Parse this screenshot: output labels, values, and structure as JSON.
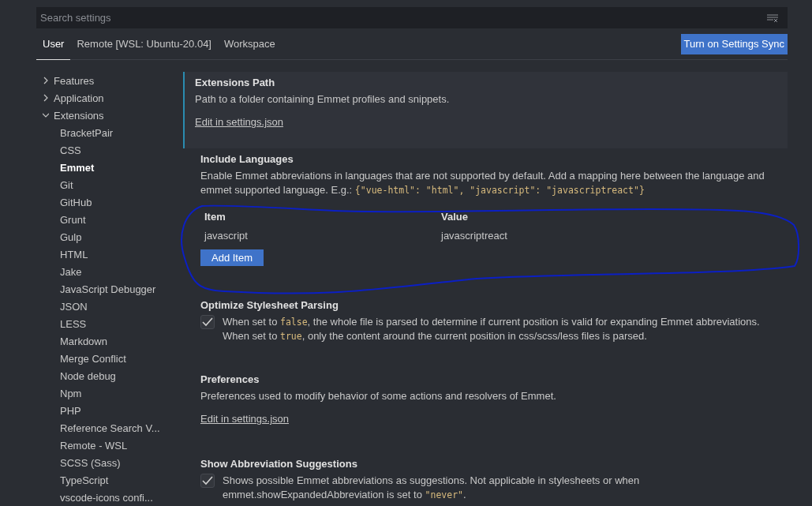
{
  "search": {
    "placeholder": "Search settings"
  },
  "tabs": [
    {
      "label": "User",
      "selected": true
    },
    {
      "label": "Remote [WSL: Ubuntu-20.04]",
      "selected": false
    },
    {
      "label": "Workspace",
      "selected": false
    }
  ],
  "sync_button": "Turn on Settings Sync",
  "sidebar": {
    "items": [
      {
        "label": "Features",
        "expanded": false,
        "selected": false
      },
      {
        "label": "Application",
        "expanded": false,
        "selected": false
      },
      {
        "label": "Extensions",
        "expanded": true,
        "selected": false,
        "children": [
          {
            "label": "BracketPair",
            "selected": false
          },
          {
            "label": "CSS",
            "selected": false
          },
          {
            "label": "Emmet",
            "selected": true
          },
          {
            "label": "Git",
            "selected": false
          },
          {
            "label": "GitHub",
            "selected": false
          },
          {
            "label": "Grunt",
            "selected": false
          },
          {
            "label": "Gulp",
            "selected": false
          },
          {
            "label": "HTML",
            "selected": false
          },
          {
            "label": "Jake",
            "selected": false
          },
          {
            "label": "JavaScript Debugger",
            "selected": false
          },
          {
            "label": "JSON",
            "selected": false
          },
          {
            "label": "LESS",
            "selected": false
          },
          {
            "label": "Markdown",
            "selected": false
          },
          {
            "label": "Merge Conflict",
            "selected": false
          },
          {
            "label": "Node debug",
            "selected": false
          },
          {
            "label": "Npm",
            "selected": false
          },
          {
            "label": "PHP",
            "selected": false
          },
          {
            "label": "Reference Search V...",
            "selected": false
          },
          {
            "label": "Remote - WSL",
            "selected": false
          },
          {
            "label": "SCSS (Sass)",
            "selected": false
          },
          {
            "label": "TypeScript",
            "selected": false
          },
          {
            "label": "vscode-icons confi...",
            "selected": false
          }
        ]
      }
    ]
  },
  "settings": [
    {
      "kind": "link",
      "title": "Extensions Path",
      "focused": true,
      "description": [
        {
          "kind": "text",
          "text": "Path to a folder containing Emmet profiles and snippets."
        }
      ],
      "link": "Edit in settings.json"
    },
    {
      "kind": "list",
      "title": "Include Languages",
      "focused": false,
      "description": [
        {
          "kind": "text",
          "text": "Enable Emmet abbreviations in languages that are not supported by default. Add a mapping here between the language and emmet supported language. E.g.: "
        },
        {
          "kind": "code",
          "text": "{\"vue-html\": \"html\", \"javascript\": \"javascriptreact\"}"
        }
      ],
      "columns": [
        "Item",
        "Value"
      ],
      "rows": [
        [
          "javascript",
          "javascriptreact"
        ]
      ],
      "button": "Add Item"
    },
    {
      "kind": "checkbox",
      "title": "Optimize Stylesheet Parsing",
      "focused": false,
      "checked": true,
      "description": [
        {
          "kind": "text",
          "text": "When set to "
        },
        {
          "kind": "code",
          "text": "false"
        },
        {
          "kind": "text",
          "text": ", the whole file is parsed to determine if current position is valid for expanding Emmet abbreviations. When set to "
        },
        {
          "kind": "code",
          "text": "true"
        },
        {
          "kind": "text",
          "text": ", only the content around the current position in css/scss/less files is parsed."
        }
      ]
    },
    {
      "kind": "link",
      "title": "Preferences",
      "focused": false,
      "description": [
        {
          "kind": "text",
          "text": "Preferences used to modify behavior of some actions and resolvers of Emmet."
        }
      ],
      "link": "Edit in settings.json"
    },
    {
      "kind": "checkbox",
      "title": "Show Abbreviation Suggestions",
      "focused": false,
      "checked": true,
      "description": [
        {
          "kind": "text",
          "text": "Shows possible Emmet abbreviations as suggestions. Not applicable in stylesheets or when emmet.showExpandedAbbreviation is set to "
        },
        {
          "kind": "code",
          "text": "\"never\""
        },
        {
          "kind": "text",
          "text": "."
        }
      ]
    }
  ]
}
